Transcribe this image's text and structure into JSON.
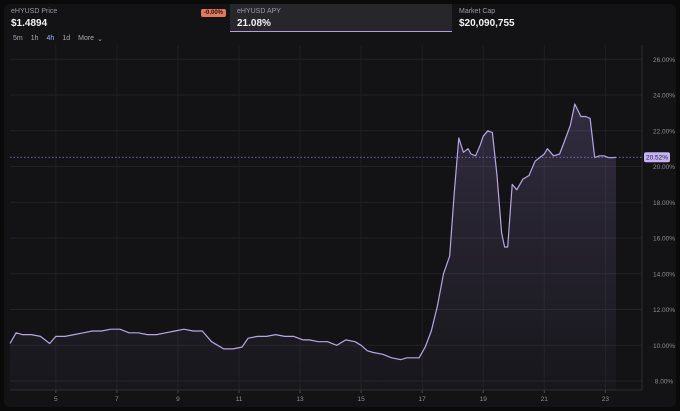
{
  "stats": {
    "price": {
      "label": "eHYUSD Price",
      "value": "$1.4894",
      "change": "-0.00%"
    },
    "apy": {
      "label": "eHYUSD APY",
      "value": "21.08%"
    },
    "market_cap": {
      "label": "Market Cap",
      "value": "$20,090,755"
    }
  },
  "intervals": {
    "items": [
      "5m",
      "1h",
      "4h",
      "1d"
    ],
    "active": "4h",
    "more_label": "More"
  },
  "colors": {
    "accent": "#b59ce6",
    "badge": "#e0795d",
    "line": "#b8a6e0",
    "crosshair": "#8b7cf0"
  },
  "chart_data": {
    "type": "area",
    "x_ticks": [
      "5",
      "7",
      "9",
      "11",
      "13",
      "15",
      "17",
      "19",
      "21",
      "23"
    ],
    "x_range": [
      3.5,
      24.2
    ],
    "y_ticks": [
      "8.00%",
      "10.00%",
      "12.00%",
      "14.00%",
      "16.00%",
      "18.00%",
      "20.00%",
      "22.00%",
      "24.00%",
      "26.00%"
    ],
    "ylim": [
      7.5,
      26.8
    ],
    "current_value_label": "20.52%",
    "current_value": 20.52,
    "grid": true,
    "x": [
      3.5,
      3.7,
      3.9,
      4.2,
      4.5,
      4.8,
      5.0,
      5.3,
      5.6,
      5.9,
      6.2,
      6.5,
      6.8,
      7.1,
      7.4,
      7.7,
      8.0,
      8.3,
      8.6,
      8.9,
      9.2,
      9.5,
      9.8,
      10.1,
      10.3,
      10.5,
      10.8,
      11.1,
      11.3,
      11.6,
      11.9,
      12.2,
      12.5,
      12.8,
      13.1,
      13.3,
      13.6,
      13.9,
      14.2,
      14.5,
      14.8,
      15.0,
      15.2,
      15.4,
      15.7,
      16.0,
      16.3,
      16.5,
      16.7,
      16.9,
      17.1,
      17.3,
      17.5,
      17.7,
      17.9,
      18.05,
      18.2,
      18.35,
      18.5,
      18.6,
      18.75,
      18.9,
      19.0,
      19.15,
      19.3,
      19.45,
      19.6,
      19.7,
      19.8,
      19.95,
      20.1,
      20.3,
      20.5,
      20.7,
      20.85,
      21.0,
      21.1,
      21.3,
      21.5,
      21.7,
      21.85,
      22.0,
      22.2,
      22.35,
      22.5,
      22.65,
      22.8,
      22.95,
      23.1,
      23.25,
      23.35
    ],
    "y": [
      10.1,
      10.7,
      10.6,
      10.6,
      10.5,
      10.1,
      10.5,
      10.5,
      10.6,
      10.7,
      10.8,
      10.8,
      10.9,
      10.9,
      10.7,
      10.7,
      10.6,
      10.6,
      10.7,
      10.8,
      10.9,
      10.8,
      10.8,
      10.2,
      10.0,
      9.8,
      9.8,
      9.9,
      10.4,
      10.5,
      10.5,
      10.6,
      10.5,
      10.5,
      10.3,
      10.3,
      10.2,
      10.2,
      10.0,
      10.3,
      10.2,
      10.0,
      9.7,
      9.6,
      9.5,
      9.3,
      9.2,
      9.3,
      9.3,
      9.3,
      9.9,
      10.8,
      12.2,
      14.0,
      15.0,
      18.5,
      21.6,
      20.8,
      21.0,
      20.7,
      20.6,
      21.2,
      21.7,
      22.0,
      21.9,
      19.5,
      16.3,
      15.5,
      15.5,
      19.0,
      18.7,
      19.3,
      19.5,
      20.3,
      20.5,
      20.7,
      21.0,
      20.6,
      20.7,
      21.6,
      22.3,
      23.5,
      22.8,
      22.8,
      22.7,
      20.5,
      20.6,
      20.6,
      20.5,
      20.5,
      20.52
    ]
  }
}
